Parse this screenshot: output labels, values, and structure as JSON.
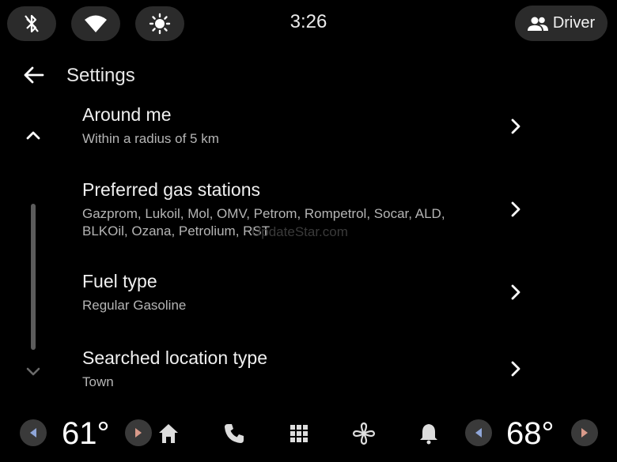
{
  "status": {
    "time": "3:26",
    "profile_label": "Driver",
    "icons": [
      "bluetooth-icon",
      "wifi-icon",
      "brightness-icon",
      "profile-icon"
    ]
  },
  "header": {
    "title": "Settings",
    "back_icon": "back-arrow-icon"
  },
  "items": [
    {
      "title": "Around me",
      "subtitle": "Within a radius of 5 km"
    },
    {
      "title": "Preferred gas stations",
      "subtitle": "Gazprom, Lukoil, Mol, OMV, Petrom, Rompetrol, Socar, ALD,\nBLKOil, Ozana, Petrolium, RST"
    },
    {
      "title": "Fuel type",
      "subtitle": "Regular Gasoline"
    },
    {
      "title": "Searched location type",
      "subtitle": "Town"
    }
  ],
  "watermark": "UpdateStar.com",
  "climate": {
    "left_temp": "61°",
    "right_temp": "68°"
  },
  "nav_icons": [
    "home-icon",
    "phone-icon",
    "apps-grid-icon",
    "fan-icon",
    "bell-icon"
  ],
  "colors": {
    "background": "#000000",
    "pill": "#2b2b2b",
    "text_secondary": "#b5b5b5",
    "left_arrow": "#8fa6d8",
    "right_arrow": "#d99a8a"
  }
}
